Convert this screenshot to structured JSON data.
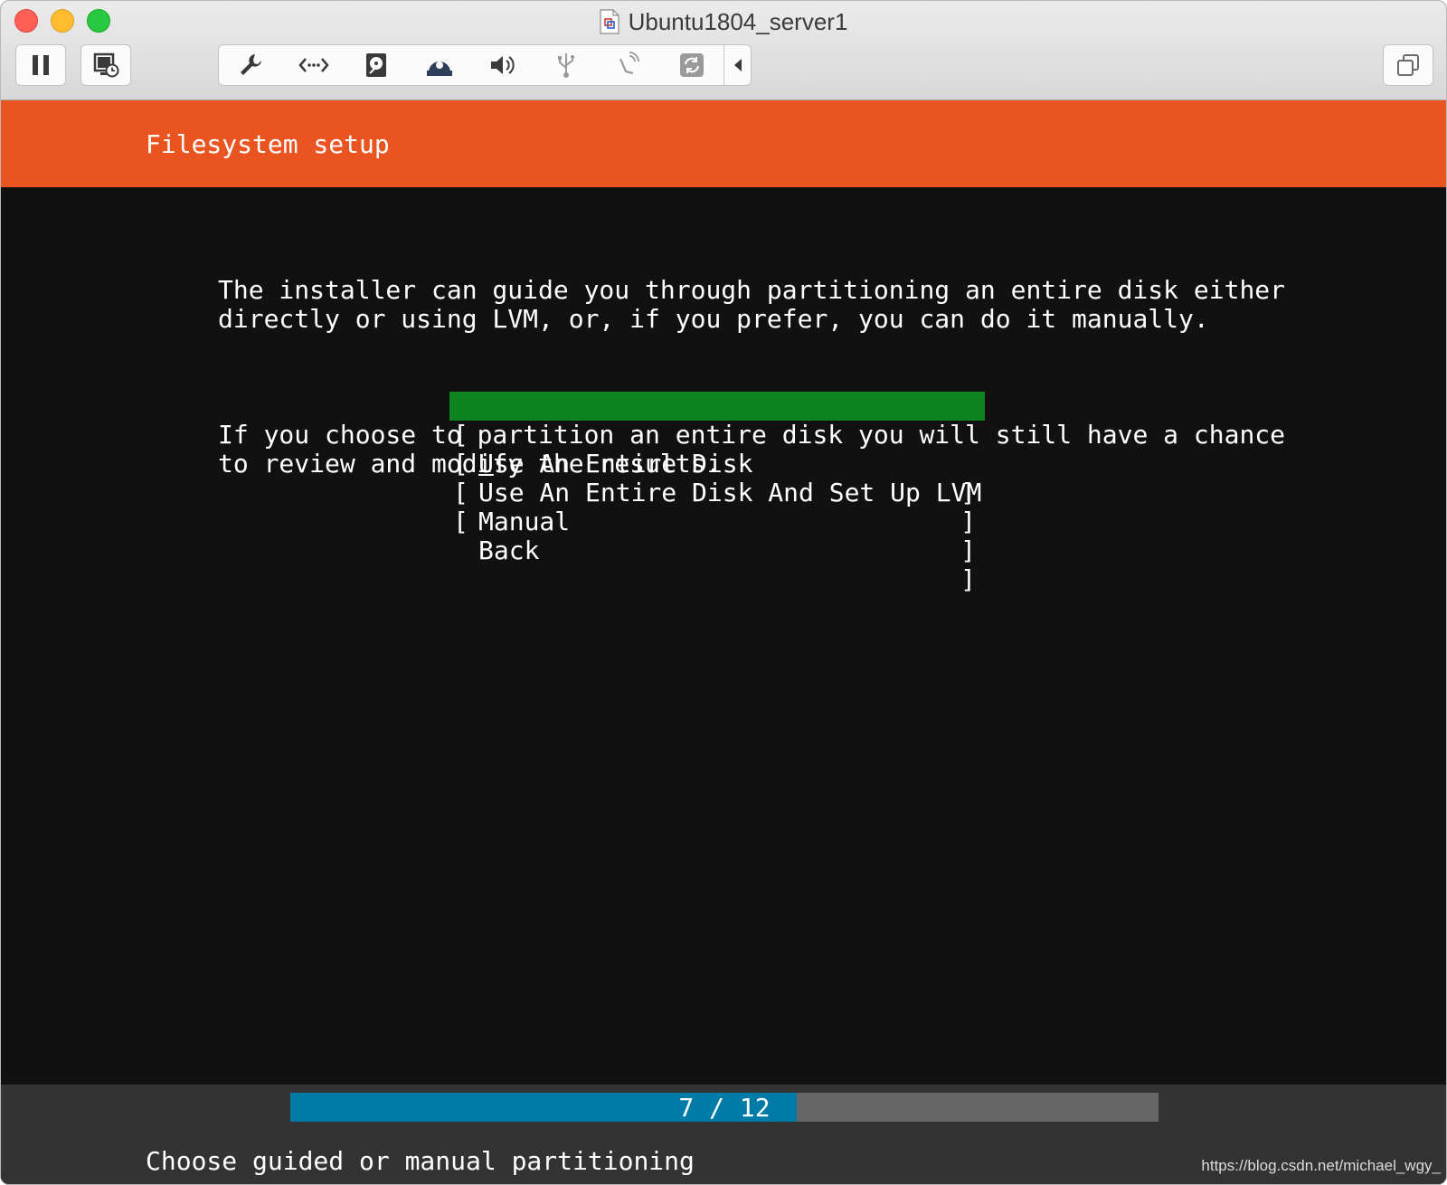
{
  "window": {
    "title": "Ubuntu1804_server1"
  },
  "toolbar": {
    "left_buttons": [
      "pause-icon",
      "snapshot-icon"
    ],
    "devices": [
      "wrench-icon",
      "network-icon",
      "hard-disk-icon",
      "cd-dvd-icon",
      "sound-icon",
      "usb-icon",
      "bluetooth-icon",
      "sync-icon"
    ],
    "collapse_icon": "triangle-left-icon",
    "right_button": "fullscreen-icon"
  },
  "installer": {
    "header": "Filesystem setup",
    "paragraphs": [
      "The installer can guide you through partitioning an entire disk either\ndirectly or using LVM, or, if you prefer, you can do it manually.",
      "If you choose to partition an entire disk you will still have a chance\nto review and modify the results."
    ],
    "menu": [
      {
        "label_first": "U",
        "label_rest": "se An Entire Disk",
        "selected": true
      },
      {
        "label": "Use An Entire Disk And Set Up LVM",
        "selected": false
      },
      {
        "label": "Manual",
        "selected": false
      },
      {
        "label": "Back",
        "selected": false
      }
    ],
    "bracket_left": "[",
    "bracket_right": "]",
    "progress": {
      "current": 7,
      "total": 12,
      "text": "7 / 12"
    },
    "footer_help": "Choose guided or manual partitioning"
  },
  "watermark": "https://blog.csdn.net/michael_wgy_",
  "colors": {
    "header": "#e95420",
    "selected": "#0e8420",
    "progress_fill": "#007aa6",
    "progress_track": "#666666",
    "screen_bg": "#111111",
    "footer_bg": "#333333"
  }
}
